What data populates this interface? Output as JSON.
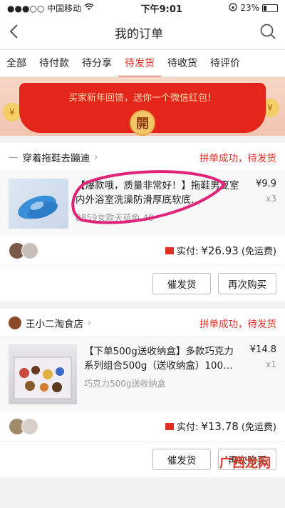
{
  "status_bar": {
    "carrier": "●●●○○ 中国移动",
    "time": "下午9:01",
    "battery": "23%",
    "battery_level": 0.23
  },
  "nav": {
    "title": "我的订单"
  },
  "tabs": [
    "全部",
    "待付款",
    "待分享",
    "待发货",
    "待收货",
    "待评价"
  ],
  "active_tab": 3,
  "banner": {
    "text": "买家新年回馈，送你一个微信红包！",
    "open_label": "開",
    "coin_symbol": "¥"
  },
  "orders": [
    {
      "shop_name": "穿着拖鞋去蹦迪",
      "status": "拼单成功，待发货",
      "title": "【爆款哦，质量非常好！】拖鞋男夏室内外浴室洗澡防滑厚底软底…",
      "spec": "8859女款天蓝色  40",
      "price": "¥9.9",
      "qty": "x3",
      "paid_label": "实付:",
      "paid_amount": "¥26.93",
      "shipping": "(免运费)",
      "btn_urge": "催发货",
      "btn_rebuy": "再次购买"
    },
    {
      "shop_name": "王小二淘食店",
      "status": "拼单成功，待发货",
      "title": "【下单500g送收纳盒】多款巧克力系列组合500g（送收纳盒）100…",
      "spec": "巧克力500g送收纳盒",
      "price": "¥14.8",
      "qty": "x1",
      "paid_label": "实付:",
      "paid_amount": "¥13.78",
      "shipping": "(免运费)",
      "btn_urge": "催发货",
      "btn_rebuy": "再次购买"
    }
  ],
  "watermark": "广西龙网",
  "colors": {
    "accent": "#e02e24",
    "banner": "#e4251a"
  }
}
